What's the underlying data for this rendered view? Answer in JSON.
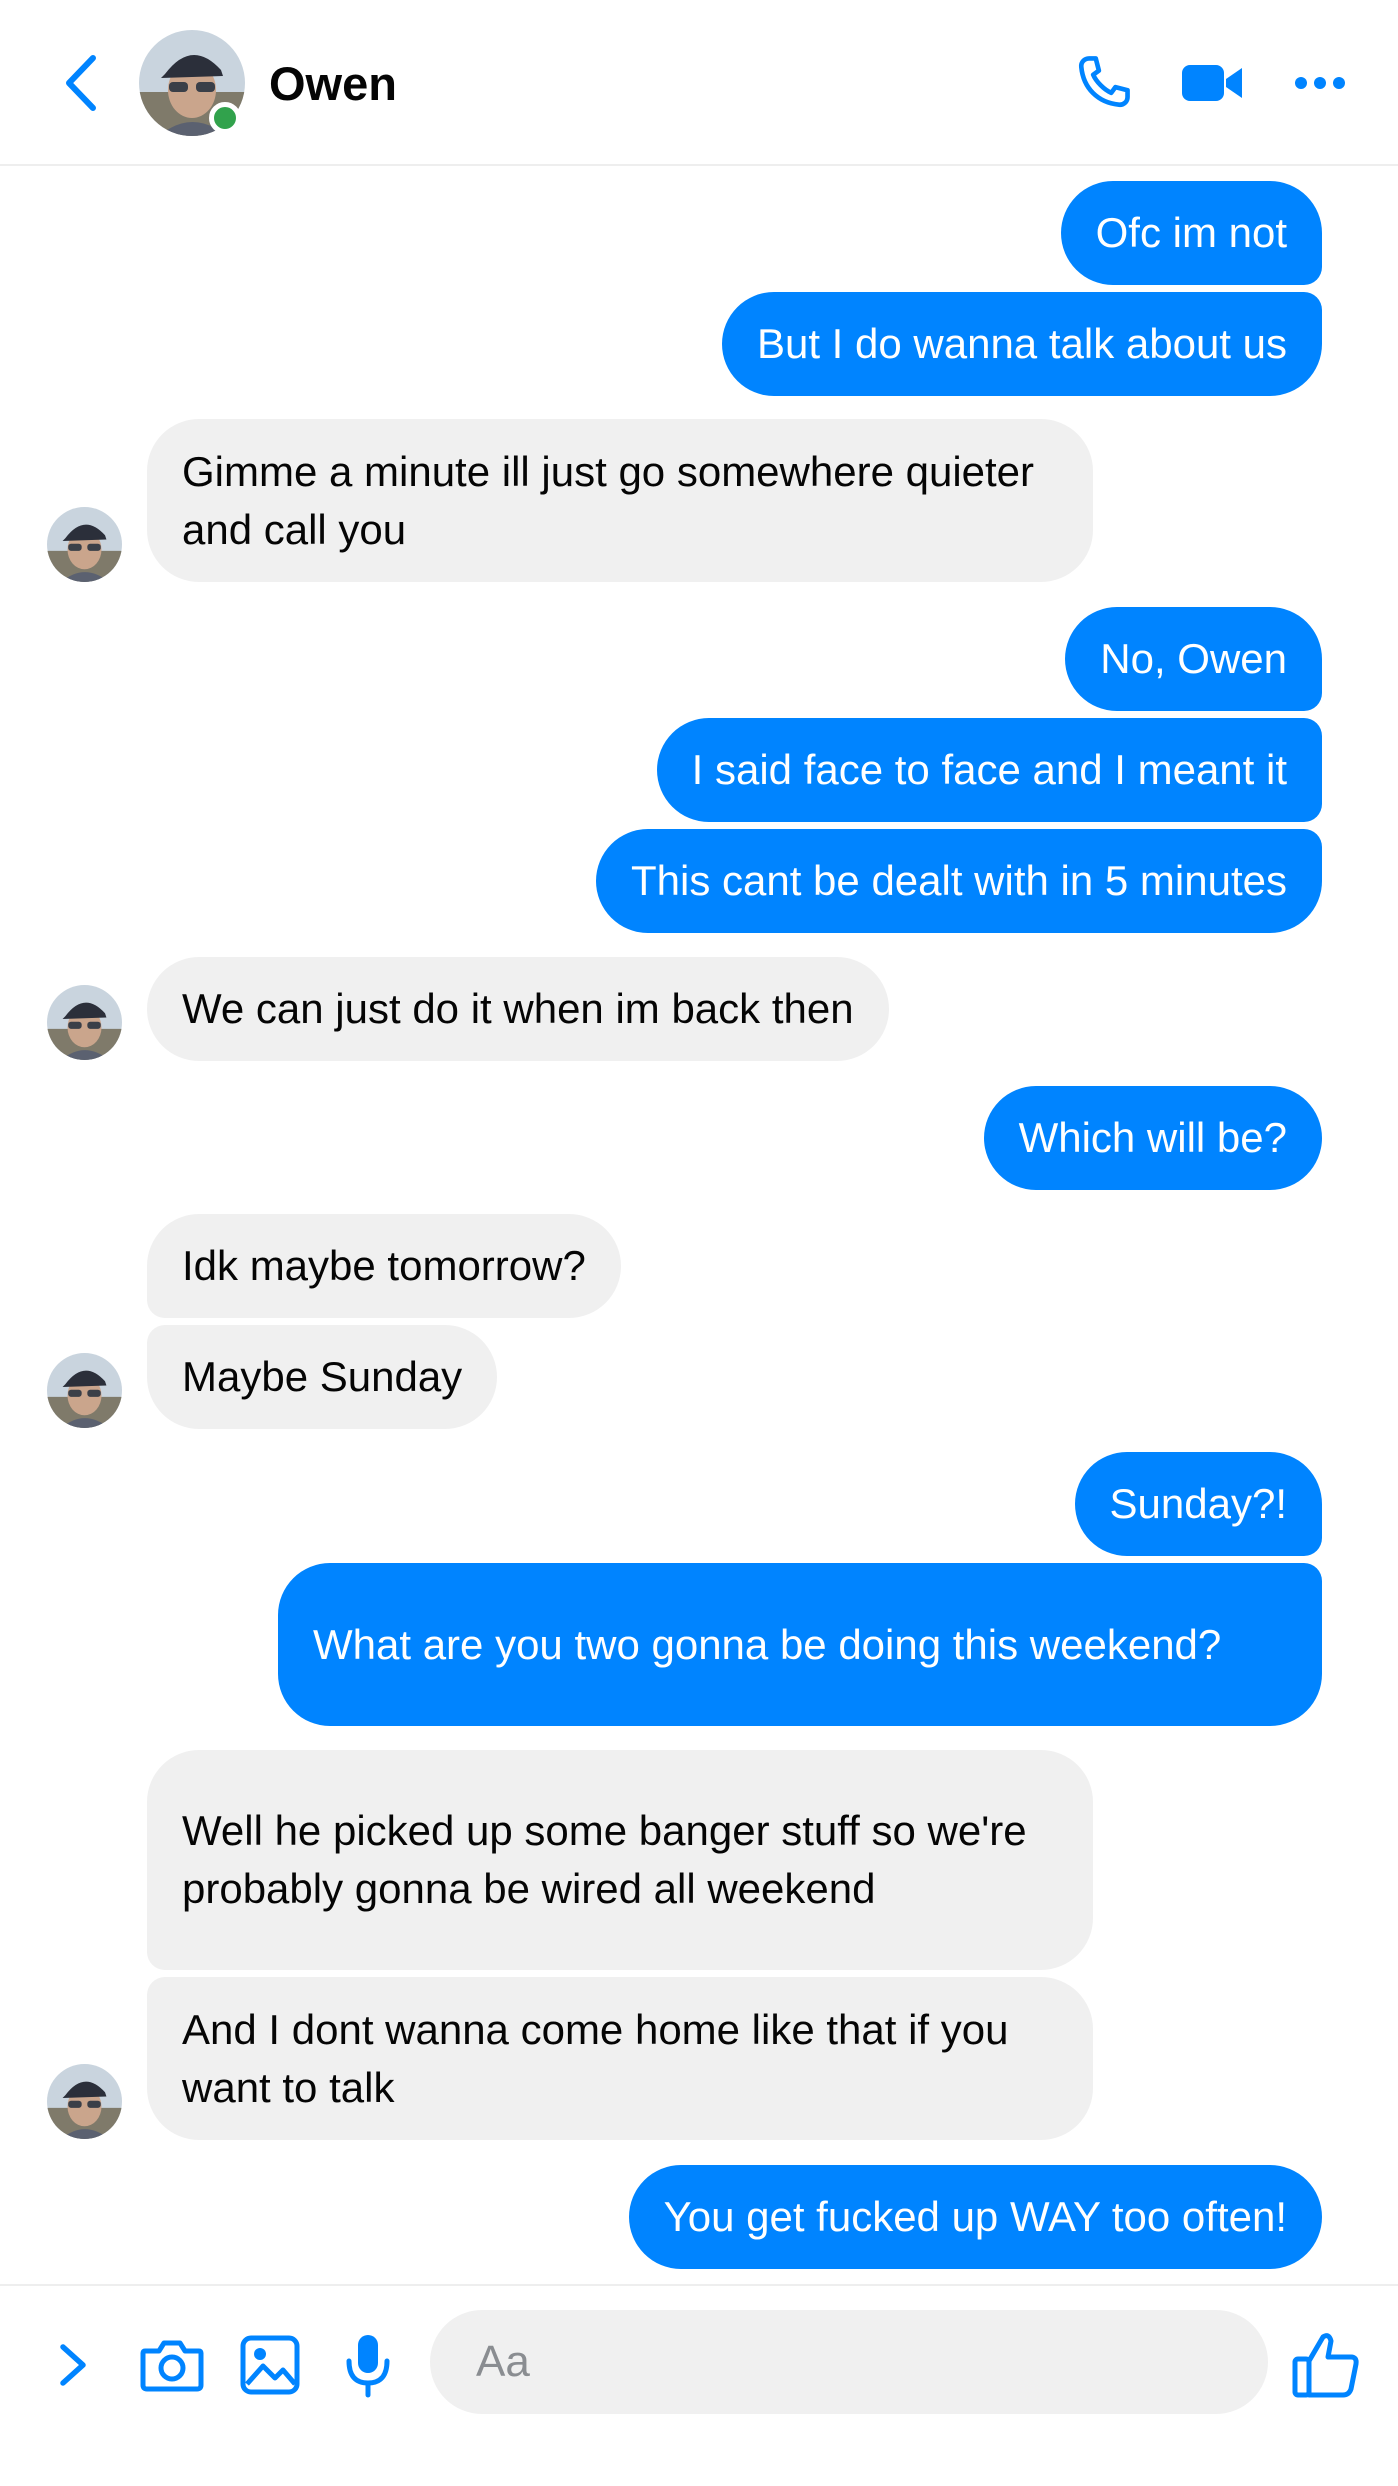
{
  "contact": {
    "name": "Owen"
  },
  "colors": {
    "accent": "#0084ff",
    "outgoing_bubble": "#0084ff",
    "incoming_bubble": "#f0f0f0",
    "online": "#31a24c"
  },
  "header": {
    "icons": [
      "back-chevron-icon",
      "phone-icon",
      "video-camera-icon",
      "more-dots-icon"
    ]
  },
  "messages": [
    {
      "from": "me",
      "text": "Ofc im not"
    },
    {
      "from": "me",
      "text": "But I do wanna talk about us"
    },
    {
      "from": "owen",
      "text": "Gimme a minute ill just go somewhere quieter and call you"
    },
    {
      "from": "me",
      "text": "No, Owen"
    },
    {
      "from": "me",
      "text": "I said face to face and I meant it"
    },
    {
      "from": "me",
      "text": "This cant be dealt with in 5 minutes"
    },
    {
      "from": "owen",
      "text": "We can just do it when im back then"
    },
    {
      "from": "me",
      "text": "Which will be?"
    },
    {
      "from": "owen",
      "text": "Idk maybe tomorrow?"
    },
    {
      "from": "owen",
      "text": "Maybe Sunday"
    },
    {
      "from": "me",
      "text": "Sunday?!"
    },
    {
      "from": "me",
      "text": "What are you two gonna be doing this weekend?"
    },
    {
      "from": "owen",
      "text": "Well he picked up some banger stuff so we're probably gonna be wired all weekend"
    },
    {
      "from": "owen",
      "text": "And I dont wanna come home like that if you want to talk"
    },
    {
      "from": "me",
      "text": "You get fucked up WAY too often!"
    }
  ],
  "composer": {
    "placeholder": "Aa",
    "icons": [
      "expand-chevron-icon",
      "camera-icon",
      "image-icon",
      "microphone-icon",
      "thumbs-up-icon"
    ]
  }
}
